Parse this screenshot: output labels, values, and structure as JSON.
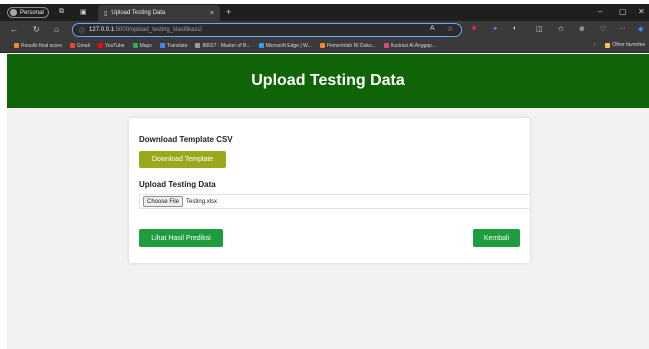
{
  "browser": {
    "profile_label": "Personal",
    "tab_title": "Upload Testing Data",
    "tab_close": "×",
    "new_tab": "+",
    "url_host": "127.0.0.1",
    "url_path": ":5000/upload_testing_klasifikasi2",
    "bookmarks": [
      {
        "label": "Results final score",
        "color": "#e88b2d"
      },
      {
        "label": "Gmail",
        "color": "#ea4335"
      },
      {
        "label": "YouTube",
        "color": "#ff0000"
      },
      {
        "label": "Maps",
        "color": "#34a853"
      },
      {
        "label": "Translate",
        "color": "#4285f4"
      },
      {
        "label": "88027 - Master of B...",
        "color": "#9c9c9c"
      },
      {
        "label": "Microsoft Edge | W...",
        "color": "#29a3e6"
      },
      {
        "label": "Pemerintah RI Duku...",
        "color": "#f08a24"
      },
      {
        "label": "Ilustrasi Al Anggap...",
        "color": "#d04a8a"
      }
    ],
    "other_favorites": "Other favorites"
  },
  "page": {
    "title": "Upload Testing Data",
    "download_section_title": "Download Template CSV",
    "download_button": "Download Template",
    "upload_section_title": "Upload Testing Data",
    "choose_file_button": "Choose File",
    "file_name": "Testing.xlsx",
    "predict_button": "Lihat Hasil Prediksi",
    "back_button": "Kembali"
  },
  "colors": {
    "header_bg": "#0f6407",
    "download_button_bg": "#9aa81c",
    "action_button_bg": "#1e9c3e"
  }
}
